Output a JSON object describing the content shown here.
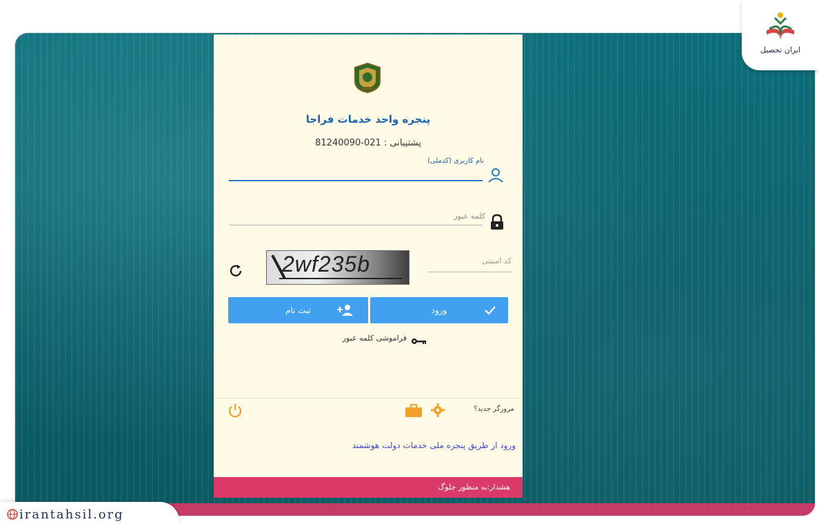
{
  "brand": {
    "logo_text": "ایران تحصیل",
    "site": "irantahsil.org"
  },
  "page": {
    "title": "پنجره واحد خدمات فراجا",
    "support": "پشتیبانی : 021-81240090"
  },
  "form": {
    "username_label": "نام کاربری (کدملی)",
    "password_placeholder": "کلمه عبور",
    "captcha_label": "کد امنیتی",
    "captcha_text": "2wf235b",
    "login_label": "ورود",
    "register_label": "ثبت نام",
    "forgot_label": "فراموشی کلمه عبور"
  },
  "footer": {
    "new_browser": "مرورگر جدید؟",
    "gov_link": "ورود از طریق پنجره ملی خدمات دولت هوشمند",
    "warning": "هشدار:به منظور جلوگ"
  },
  "colors": {
    "primary": "#42a0f0",
    "title": "#1e63b3",
    "warning": "#d93a67",
    "icons_orange": "#f0a12a"
  }
}
